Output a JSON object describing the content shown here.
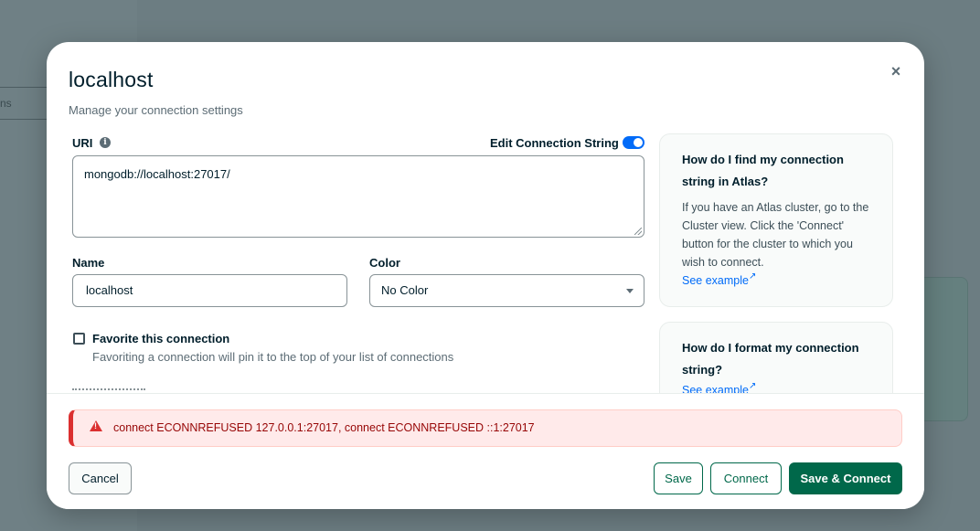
{
  "background": {
    "sidebar_fragment": "ns"
  },
  "modal": {
    "title": "localhost",
    "subtitle": "Manage your connection settings",
    "close_symbol": "×"
  },
  "uri": {
    "label": "URI",
    "info_symbol": "i",
    "edit_toggle_label": "Edit Connection String",
    "edit_toggle_on": true,
    "value": "mongodb://localhost:27017/"
  },
  "name": {
    "label": "Name",
    "value": "localhost"
  },
  "color": {
    "label": "Color",
    "selected": "No Color"
  },
  "favorite": {
    "label": "Favorite this connection",
    "description": "Favoriting a connection will pin it to the top of your list of connections",
    "checked": false
  },
  "help": [
    {
      "title": "How do I find my connection string in Atlas?",
      "body": "If you have an Atlas cluster, go to the Cluster view. Click the 'Connect' button for the cluster to which you wish to connect.",
      "link": "See example"
    },
    {
      "title": "How do I format my connection string?",
      "link": "See example"
    }
  ],
  "error": {
    "message": "connect ECONNREFUSED 127.0.0.1:27017, connect ECONNREFUSED ::1:27017"
  },
  "buttons": {
    "cancel": "Cancel",
    "save": "Save",
    "connect": "Connect",
    "save_connect": "Save & Connect"
  },
  "colors": {
    "primary_green": "#00684a",
    "toggle_blue": "#016bf8",
    "error_red": "#db3030",
    "error_bg": "#ffeaea"
  }
}
